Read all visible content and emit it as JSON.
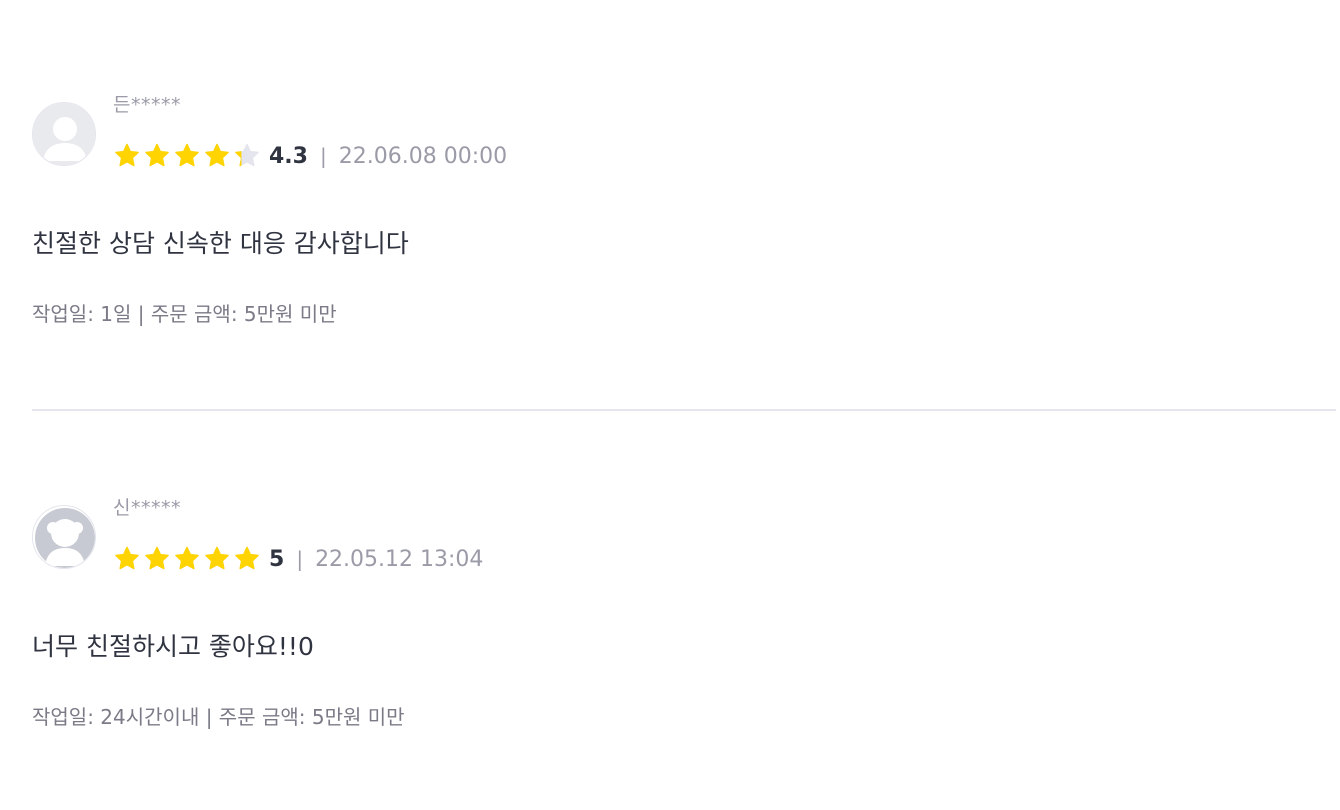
{
  "colors": {
    "star_filled": "#FFD400",
    "star_empty": "#E4E5ED",
    "text_primary": "#303441",
    "text_secondary": "#9A9BA7",
    "divider": "#E4E5ED"
  },
  "reviews": [
    {
      "username": "든*****",
      "avatar_icon": "default-user-avatar-icon",
      "rating": 4.3,
      "rating_label": "4.3",
      "date": "22.06.08 00:00",
      "comment": "친절한 상담 신속한 대응 감사합니다",
      "meta": "작업일: 1일 | 주문 금액: 5만원 미만"
    },
    {
      "username": "신*****",
      "avatar_icon": "default-user-avatar-icon",
      "rating": 5,
      "rating_label": "5",
      "date": "22.05.12 13:04",
      "comment": "너무 친절하시고 좋아요!!0",
      "meta": "작업일: 24시간이내 | 주문 금액: 5만원 미만"
    }
  ],
  "rating_separator": "|"
}
